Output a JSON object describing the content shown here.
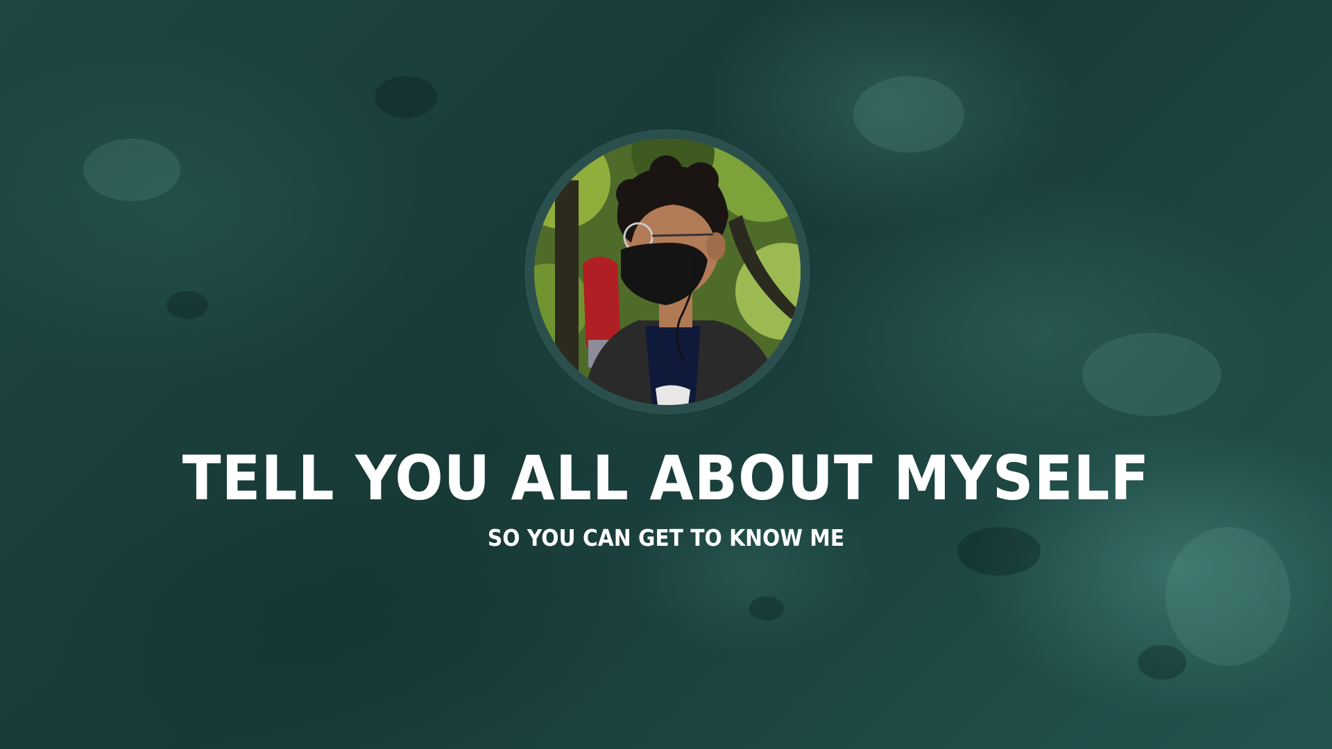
{
  "slide": {
    "title": "TELL YOU ALL ABOUT MYSELF",
    "subtitle": "SO YOU CAN GET TO KNOW ME"
  },
  "avatar": {
    "description_icon": "profile-photo"
  },
  "colors": {
    "background": "#1b3d3a",
    "avatar_ring": "#2a4f4c",
    "text": "#ffffff"
  }
}
